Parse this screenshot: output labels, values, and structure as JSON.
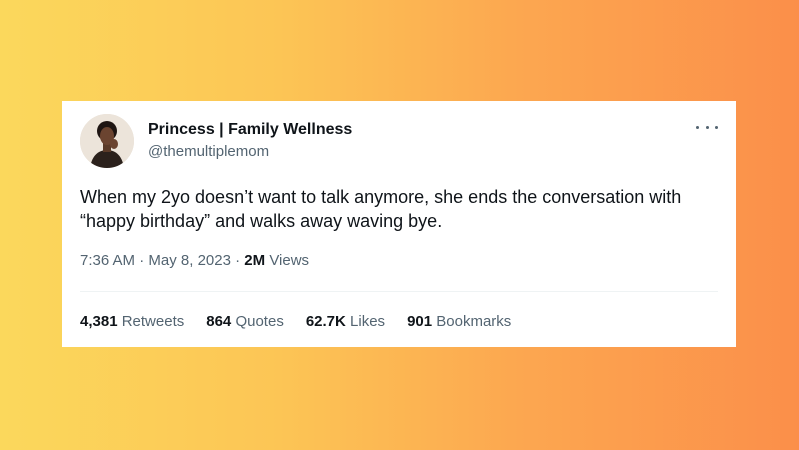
{
  "tweet": {
    "author": {
      "display_name": "Princess | Family Wellness",
      "handle": "@themultiplemom"
    },
    "text": "When my 2yo doesn’t want to talk anymore, she ends the conversation with “happy birthday” and walks away waving bye.",
    "time": "7:36 AM",
    "separator": " · ",
    "date": "May 8, 2023",
    "views_count": "2M",
    "views_label": "Views",
    "more_icon": "more-horizontal-icon"
  },
  "stats": [
    {
      "count": "4,381",
      "label": "Retweets"
    },
    {
      "count": "864",
      "label": "Quotes"
    },
    {
      "count": "62.7K",
      "label": "Likes"
    },
    {
      "count": "901",
      "label": "Bookmarks"
    }
  ],
  "colors": {
    "background_start": "#fbd85c",
    "background_end": "#fb8f4a",
    "text_primary": "#0f1419",
    "text_secondary": "#536471"
  }
}
